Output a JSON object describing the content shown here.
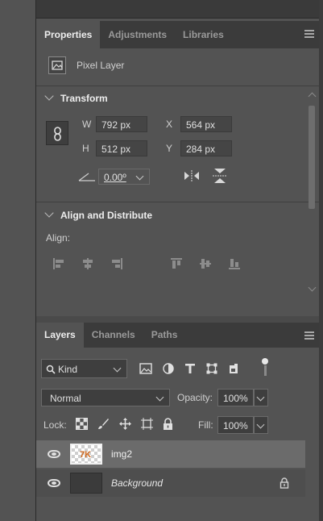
{
  "properties_panel": {
    "tabs": [
      {
        "label": "Properties",
        "active": true
      },
      {
        "label": "Adjustments",
        "active": false
      },
      {
        "label": "Libraries",
        "active": false
      }
    ],
    "layer_kind_label": "Pixel Layer",
    "transform": {
      "title": "Transform",
      "w_label": "W",
      "w_value": "792 px",
      "h_label": "H",
      "h_value": "512 px",
      "x_label": "X",
      "x_value": "564 px",
      "y_label": "Y",
      "y_value": "284 px",
      "angle_value": "0.00º"
    },
    "align": {
      "title": "Align and Distribute",
      "align_label": "Align:"
    }
  },
  "layers_panel": {
    "tabs": [
      {
        "label": "Layers",
        "active": true
      },
      {
        "label": "Channels",
        "active": false
      },
      {
        "label": "Paths",
        "active": false
      }
    ],
    "filter_kind": "Kind",
    "blend_mode": "Normal",
    "opacity_label": "Opacity:",
    "opacity_value": "100%",
    "lock_label": "Lock:",
    "fill_label": "Fill:",
    "fill_value": "100%",
    "layers": [
      {
        "name": "img2",
        "selected": true,
        "locked": false
      },
      {
        "name": "Background",
        "selected": false,
        "locked": true
      }
    ]
  },
  "colors": {
    "panel_bg": "#535353",
    "tab_bar_bg": "#3b3b3b",
    "field_bg": "#454545",
    "selected_row": "#6b6b6b",
    "accent_orange": "#d2691e"
  }
}
